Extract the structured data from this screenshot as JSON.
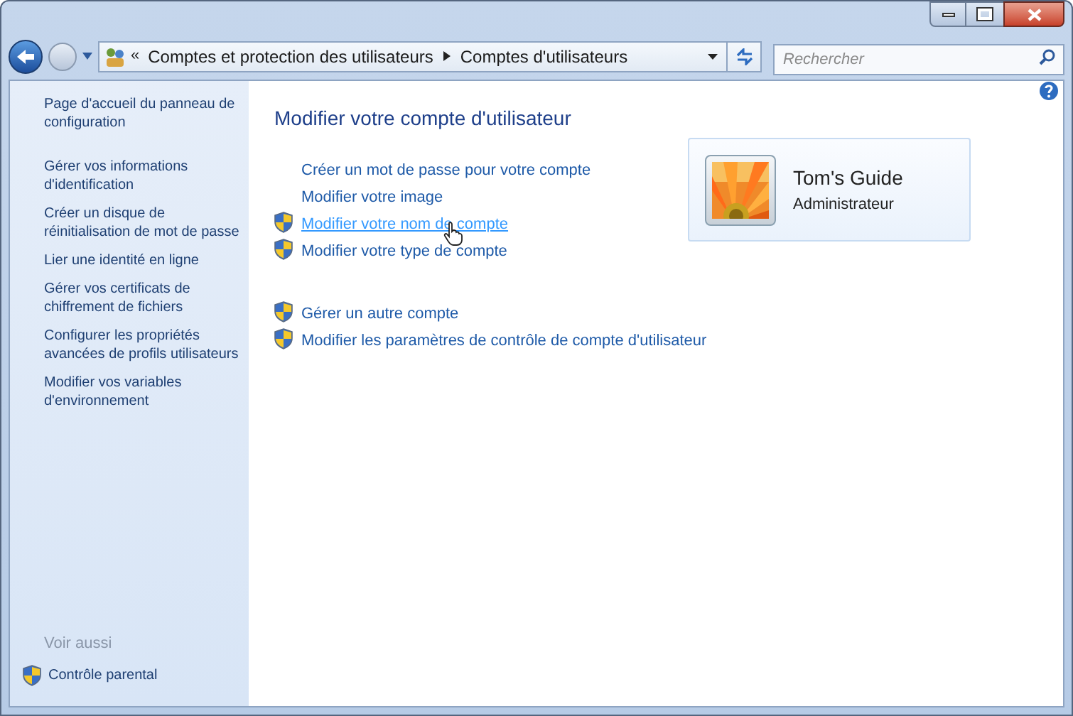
{
  "address_bar": {
    "overflow": "«",
    "crumbs": [
      "Comptes et protection des utilisateurs",
      "Comptes d'utilisateurs"
    ]
  },
  "search": {
    "placeholder": "Rechercher"
  },
  "sidebar": {
    "items": [
      "Page d'accueil du panneau de configuration",
      "Gérer vos informations d'identification",
      "Créer un disque de réinitialisation de mot de passe",
      "Lier une identité en ligne",
      "Gérer vos certificats de chiffrement de fichiers",
      "Configurer les propriétés avancées de profils utilisateurs",
      "Modifier vos variables d'environnement"
    ],
    "see_also_title": "Voir aussi",
    "see_also": [
      {
        "label": "Contrôle parental",
        "shield": true
      }
    ]
  },
  "main": {
    "title": "Modifier votre compte d'utilisateur",
    "link_groups": [
      [
        {
          "label": "Créer un mot de passe pour votre compte",
          "shield": false,
          "hovered": false
        },
        {
          "label": "Modifier votre image",
          "shield": false,
          "hovered": false
        },
        {
          "label": "Modifier votre nom de compte",
          "shield": true,
          "hovered": true
        },
        {
          "label": "Modifier votre type de compte",
          "shield": true,
          "hovered": false
        }
      ],
      [
        {
          "label": "Gérer un autre compte",
          "shield": true,
          "hovered": false
        },
        {
          "label": "Modifier les paramètres de contrôle de compte d'utilisateur",
          "shield": true,
          "hovered": false
        }
      ]
    ]
  },
  "account": {
    "name": "Tom's Guide",
    "role": "Administrateur"
  }
}
